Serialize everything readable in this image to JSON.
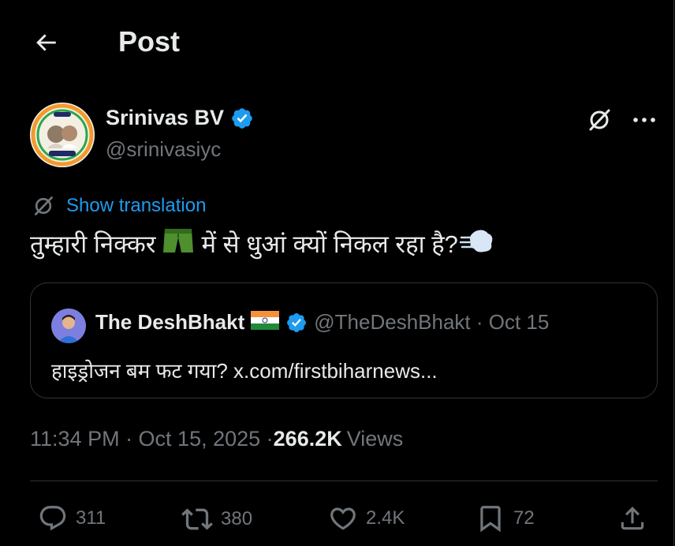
{
  "header": {
    "title": "Post",
    "back_icon": "arrow-left-icon"
  },
  "author": {
    "name": "Srinivas BV",
    "handle": "@srinivasiyc",
    "verified": true,
    "avatar_badge_text": "AZADI",
    "avatar_badge_bottom": "STOP VOTE CHORI"
  },
  "translation": {
    "label": "Show translation"
  },
  "tweet": {
    "text_before": "तुम्हारी निक्कर",
    "text_after": "में से धुआं क्यों निकल रहा है?",
    "emoji_1": "shorts-emoji",
    "emoji_2": "dashing-away-emoji"
  },
  "quote": {
    "name": "The DeshBhakt",
    "flag": "india-flag-emoji",
    "handle_date": "@TheDeshBhakt · Oct 15",
    "text": "हाइड्रोजन बम फट गया? x.com/firstbiharnews..."
  },
  "meta": {
    "time_date": "11:34 PM · Oct 15, 2025 · ",
    "views_count": "266.2K",
    "views_label": "Views"
  },
  "actions": {
    "replies": "311",
    "reposts": "380",
    "likes": "2.4K",
    "bookmarks": "72"
  },
  "colors": {
    "accent": "#1d9bf0",
    "muted": "#71767b",
    "text": "#e7e9ea",
    "border": "#2f3336",
    "background": "#000000"
  }
}
